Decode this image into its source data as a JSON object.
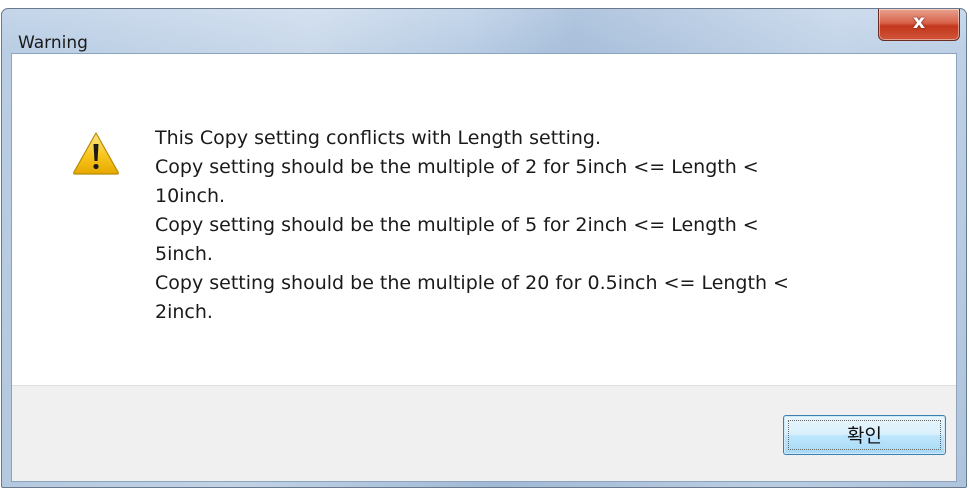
{
  "dialog": {
    "title": "Warning",
    "close_glyph": "x",
    "icon": "warning-icon",
    "message_lines": [
      "This Copy setting conflicts with Length setting.",
      "Copy setting should be the multiple of 2 for 5inch <= Length <",
      "10inch.",
      "Copy setting should be the multiple of 5 for 2inch <= Length <",
      "5inch.",
      "Copy setting should be the multiple of 20 for 0.5inch <= Length <",
      "2inch."
    ],
    "ok_label": "확인"
  },
  "colors": {
    "close_button": "#c2371d",
    "warning_fill": "#f7c51e",
    "frame": "#b9cde4"
  }
}
